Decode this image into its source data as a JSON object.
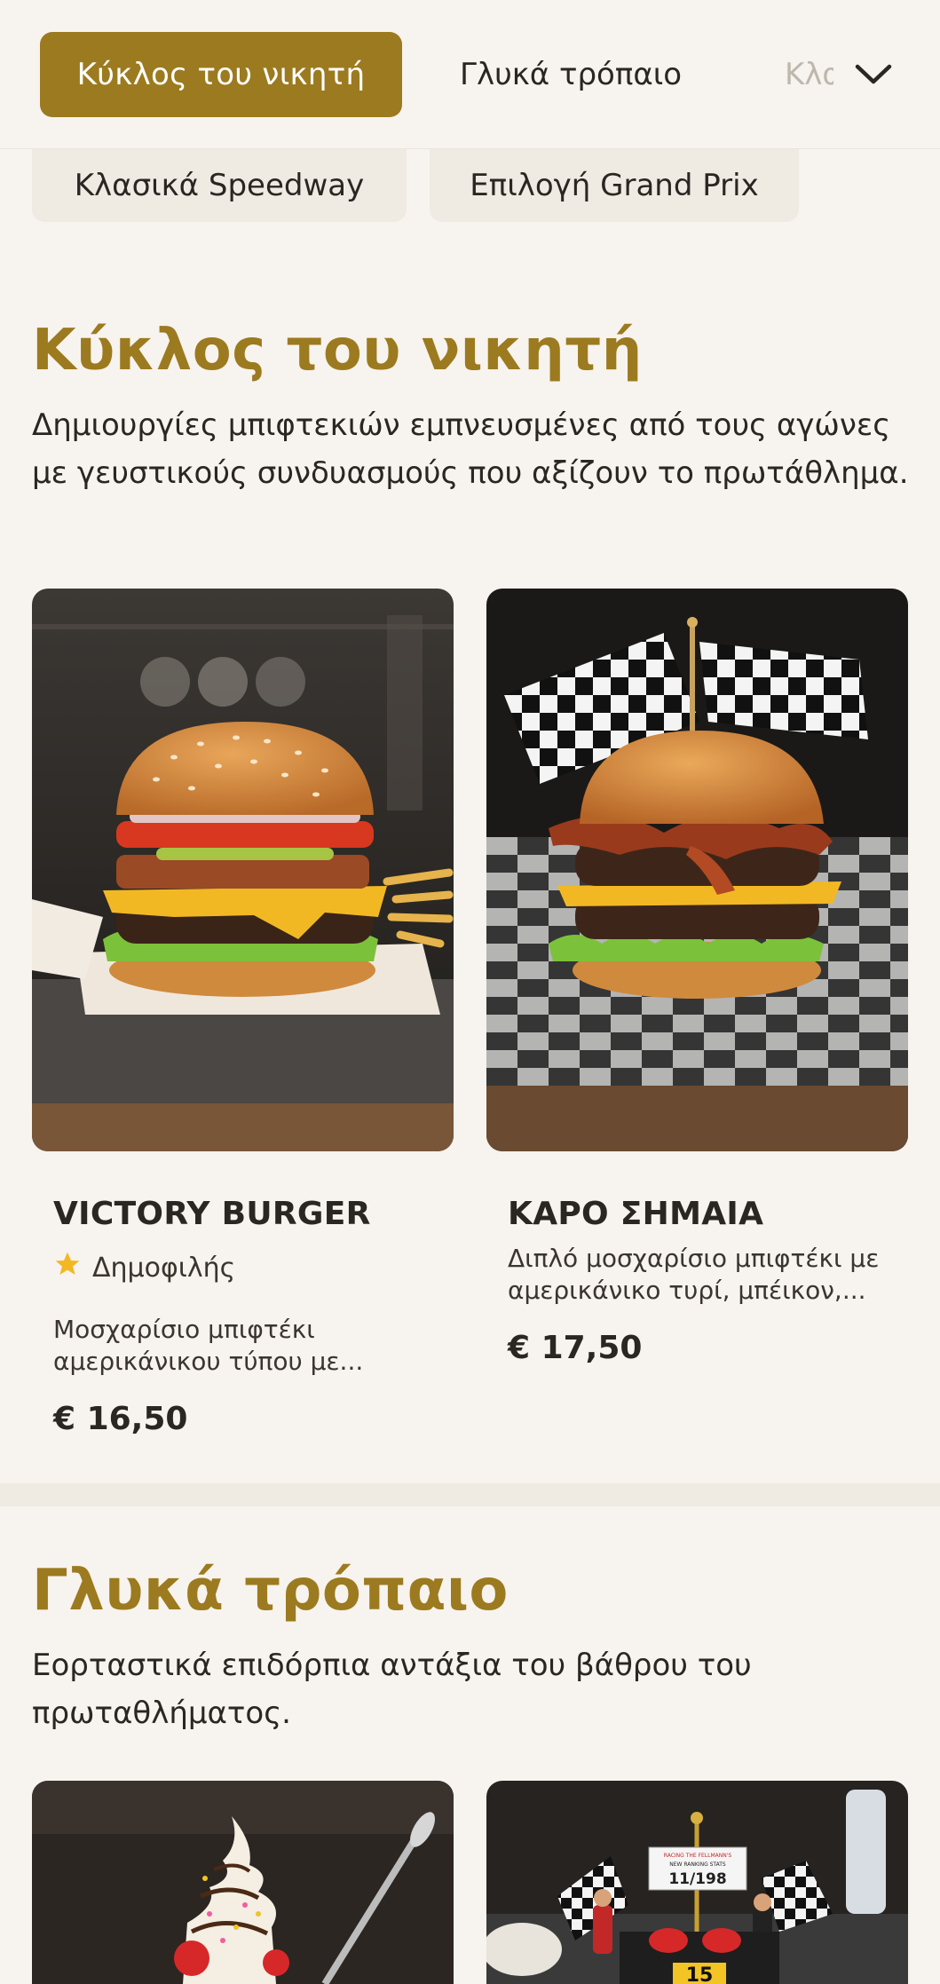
{
  "nav": {
    "active_tab": "Κύκλος του νικητή",
    "tab_2": "Γλυκά τρόπαιο",
    "tab_3_partial": "Κλασικά Speedway",
    "subtabs": [
      "Κλασικά Speedway",
      "Επιλογή Grand Prix"
    ]
  },
  "sections": [
    {
      "title": "Κύκλος του νικητή",
      "description": "Δημιουργίες μπιφτεκιών εμπνευσμένες από τους αγώνες με γευστικούς συνδυασμούς που αξίζουν το πρωτάθλημα.",
      "items": [
        {
          "name": "VICTORY BURGER",
          "badge": "Δημοφιλής",
          "description": "Μοσχαρίσιο μπιφτέκι αμερικάνικου τύπου με...",
          "price": "€ 16,50"
        },
        {
          "name": "ΚΑΡΟ ΣΗΜΑΙΑ",
          "description": "Διπλό μοσχαρίσιο μπιφτέκι με αμερικάνικο τυρί, μπέικον,...",
          "price": "€ 17,50"
        }
      ]
    },
    {
      "title": "Γλυκά τρόπαιο",
      "description": "Εορταστικά επιδόρπια αντάξια του βάθρου του πρωταθλήματος.",
      "cake_sign_line1": "RACING THE FELLMANN'S",
      "cake_sign_line2": "NEW RANKING STATS",
      "cake_sign_line3": "11/198",
      "cake_number": "15"
    }
  ],
  "colors": {
    "accent": "#9c7a1f",
    "background": "#f7f3ee",
    "chip_bg": "#efebe3",
    "star": "#f2b824"
  },
  "icons": [
    "chevron-down-icon",
    "star-icon"
  ]
}
